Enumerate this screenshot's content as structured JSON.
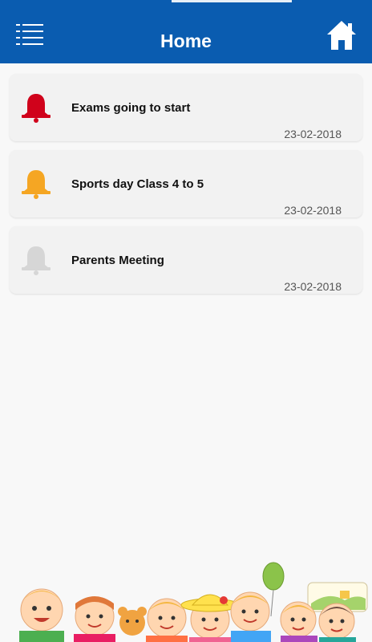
{
  "header": {
    "title": "Home",
    "background": "#0a5cb0",
    "menu_icon": "hamburger-menu-icon",
    "home_icon": "home-icon"
  },
  "notices": [
    {
      "title": "Exams going to start",
      "date": "23-02-2018",
      "bell_color": "#d0021b"
    },
    {
      "title": "Sports day Class 4 to 5",
      "date": "23-02-2018",
      "bell_color": "#f5a623"
    },
    {
      "title": "Parents Meeting",
      "date": "23-02-2018",
      "bell_color": "#d6d6d6"
    }
  ]
}
